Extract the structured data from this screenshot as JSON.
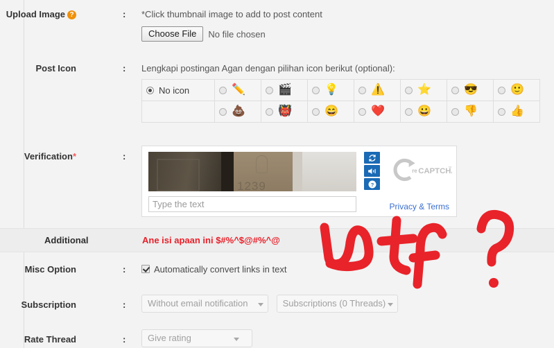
{
  "form": {
    "upload_image": {
      "label": "Upload Image",
      "help_icon": "help-circle-icon",
      "colon": ":",
      "hint": "*Click thumbnail image to add to post content",
      "choose_file_label": "Choose File",
      "no_file_text": "No file chosen"
    },
    "post_icon": {
      "label": "Post Icon",
      "colon": ":",
      "hint": "Lengkapi postingan Agan dengan pilihan icon berikut (optional):",
      "no_icon_label": "No icon",
      "selected": "no-icon",
      "row1": [
        {
          "name": "pencil-icon",
          "glyph": "✏️"
        },
        {
          "name": "clapperboard-icon",
          "glyph": "🎬"
        },
        {
          "name": "lightbulb-icon",
          "glyph": "💡"
        },
        {
          "name": "warning-icon",
          "glyph": "⚠️"
        },
        {
          "name": "star-icon",
          "glyph": "⭐"
        },
        {
          "name": "sunglasses-face-icon",
          "glyph": "😎"
        },
        {
          "name": "smiley-face-icon",
          "glyph": "🙂"
        }
      ],
      "row2": [
        {
          "name": "poop-icon",
          "glyph": "💩"
        },
        {
          "name": "red-devil-face-icon",
          "glyph": "👹"
        },
        {
          "name": "laughing-face-icon",
          "glyph": "😄"
        },
        {
          "name": "heart-icon",
          "glyph": "❤️"
        },
        {
          "name": "blue-smiley-face-icon",
          "glyph": "😀"
        },
        {
          "name": "thumbs-down-icon",
          "glyph": "👎"
        },
        {
          "name": "thumbs-up-icon",
          "glyph": "👍"
        }
      ]
    },
    "verification": {
      "label": "Verification",
      "required_mark": "*",
      "colon": ":",
      "captcha_placeholder": "Type the text",
      "captcha_number": "1239",
      "privacy_terms": "Privacy & Terms",
      "brand": "reCAPTCHA",
      "brand_prefix": "re",
      "brand_tm": "™",
      "controls": [
        {
          "name": "refresh-captcha-button"
        },
        {
          "name": "audio-captcha-button"
        },
        {
          "name": "help-captcha-button"
        }
      ]
    },
    "additional": {
      "label": "Additional",
      "note": "Ane isi apaan ini $#%^$@#%^@"
    },
    "misc_option": {
      "label": "Misc Option",
      "colon": ":",
      "checkbox_label": "Automatically convert links in text",
      "checked": true
    },
    "subscription": {
      "label": "Subscription",
      "colon": ":",
      "select_mode": "Without email notification",
      "select_threads": "Subscriptions (0 Threads)"
    },
    "rate_thread": {
      "label": "Rate Thread",
      "colon": ":",
      "select_rating": "Give rating"
    }
  },
  "annotation": {
    "text": "wtf ?",
    "color": "#e8232a"
  },
  "colors": {
    "page_bg": "#f3f3f3",
    "band_bg": "#ededed",
    "accent_red": "#e8202a",
    "link_blue": "#3a6fcf",
    "captcha_blue": "#1a6ab5",
    "help_orange": "#f0900a"
  }
}
